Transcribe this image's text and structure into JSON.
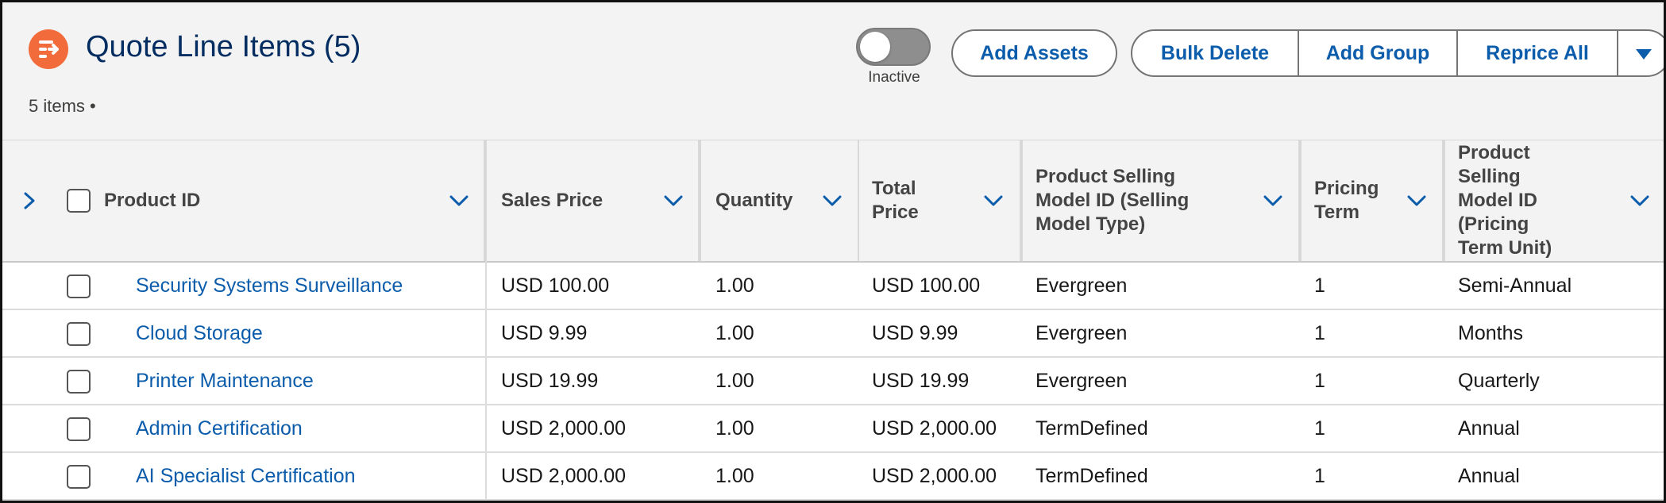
{
  "header": {
    "title": "Quote Line Items (5)",
    "item_count": "5 items •",
    "toggle": {
      "label": "Inactive",
      "state": "off"
    },
    "buttons": {
      "add_assets": "Add Assets",
      "bulk_delete": "Bulk Delete",
      "add_group": "Add Group",
      "reprice_all": "Reprice All"
    },
    "icon": "quote-line-items-icon",
    "accent_color": "#f26b3a"
  },
  "table": {
    "columns": [
      "Product ID",
      "Sales Price",
      "Quantity",
      "Total Price",
      "Product Selling Model ID (Selling Model Type)",
      "Pricing Term",
      "Product Selling Model ID (Pricing Term Unit)"
    ],
    "rows": [
      {
        "product": "Security Systems Surveillance",
        "sales_price": "USD 100.00",
        "quantity": "1.00",
        "total_price": "USD 100.00",
        "model_type": "Evergreen",
        "pricing_term": "1",
        "term_unit": "Semi-Annual"
      },
      {
        "product": "Cloud Storage",
        "sales_price": "USD 9.99",
        "quantity": "1.00",
        "total_price": "USD 9.99",
        "model_type": "Evergreen",
        "pricing_term": "1",
        "term_unit": "Months"
      },
      {
        "product": "Printer Maintenance",
        "sales_price": "USD 19.99",
        "quantity": "1.00",
        "total_price": "USD 19.99",
        "model_type": "Evergreen",
        "pricing_term": "1",
        "term_unit": "Quarterly"
      },
      {
        "product": "Admin Certification",
        "sales_price": "USD 2,000.00",
        "quantity": "1.00",
        "total_price": "USD 2,000.00",
        "model_type": "TermDefined",
        "pricing_term": "1",
        "term_unit": "Annual"
      },
      {
        "product": "AI Specialist Certification",
        "sales_price": "USD 2,000.00",
        "quantity": "1.00",
        "total_price": "USD 2,000.00",
        "model_type": "TermDefined",
        "pricing_term": "1",
        "term_unit": "Annual"
      }
    ],
    "link_color": "#0b5cab"
  }
}
